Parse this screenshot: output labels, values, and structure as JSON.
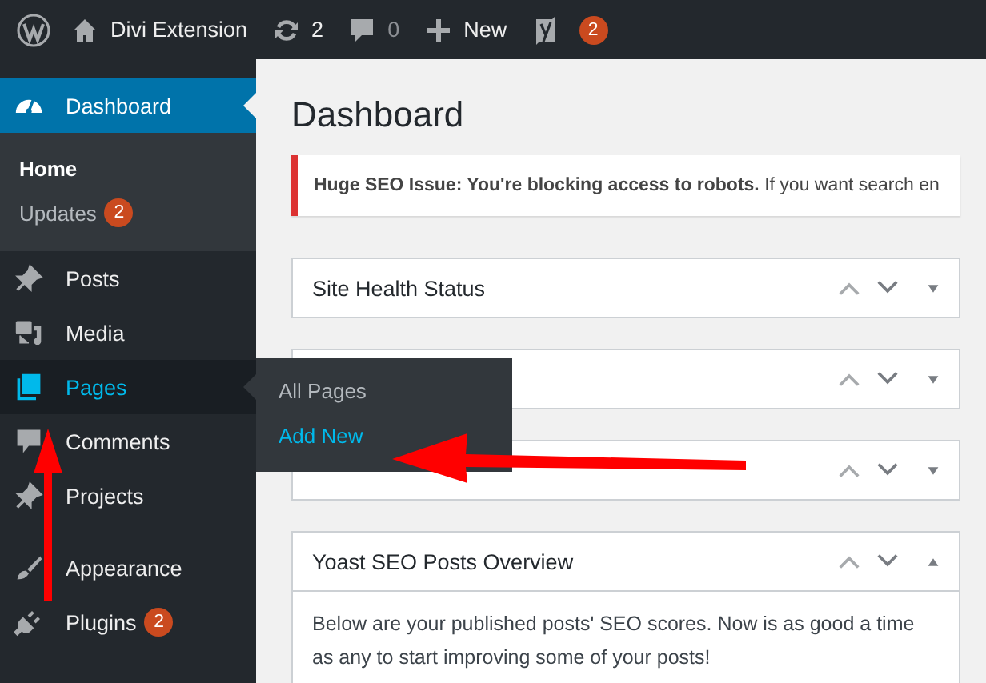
{
  "admin_bar": {
    "site_name": "Divi Extension",
    "updates_count": "2",
    "comments_count": "0",
    "new_label": "New",
    "seo_badge": "2"
  },
  "sidebar": {
    "items": [
      {
        "label": "Dashboard",
        "selected": true,
        "open": false,
        "separator_before": false,
        "children": [
          {
            "label": "Home",
            "selected": true
          },
          {
            "label": "Updates",
            "badge": "2",
            "selected": false
          }
        ]
      },
      {
        "label": "Posts",
        "selected": false,
        "open": false,
        "separator_before": false
      },
      {
        "label": "Media",
        "selected": false,
        "open": false,
        "separator_before": false
      },
      {
        "label": "Pages",
        "selected": false,
        "open": true,
        "separator_before": false
      },
      {
        "label": "Comments",
        "selected": false,
        "open": false,
        "separator_before": false
      },
      {
        "label": "Projects",
        "selected": false,
        "open": false,
        "separator_before": false
      },
      {
        "label": "Appearance",
        "selected": false,
        "open": false,
        "separator_before": true
      },
      {
        "label": "Plugins",
        "badge": "2",
        "selected": false,
        "open": false,
        "separator_before": false
      }
    ]
  },
  "flyout": {
    "items": [
      {
        "label": "All Pages",
        "selected": false
      },
      {
        "label": "Add New",
        "selected": true
      }
    ]
  },
  "main": {
    "title": "Dashboard",
    "notice": "**Huge SEO Issue: You're blocking access to robots.** If you want search en",
    "widgets": [
      {
        "title": "Site Health Status",
        "expanded": false
      },
      {
        "expanded": false
      },
      {
        "expanded": false
      },
      {
        "title": "Yoast SEO Posts Overview",
        "expanded": true,
        "body": "Below are your published posts' SEO scores. Now is as good a time as any to start improving some of your posts!"
      }
    ]
  }
}
